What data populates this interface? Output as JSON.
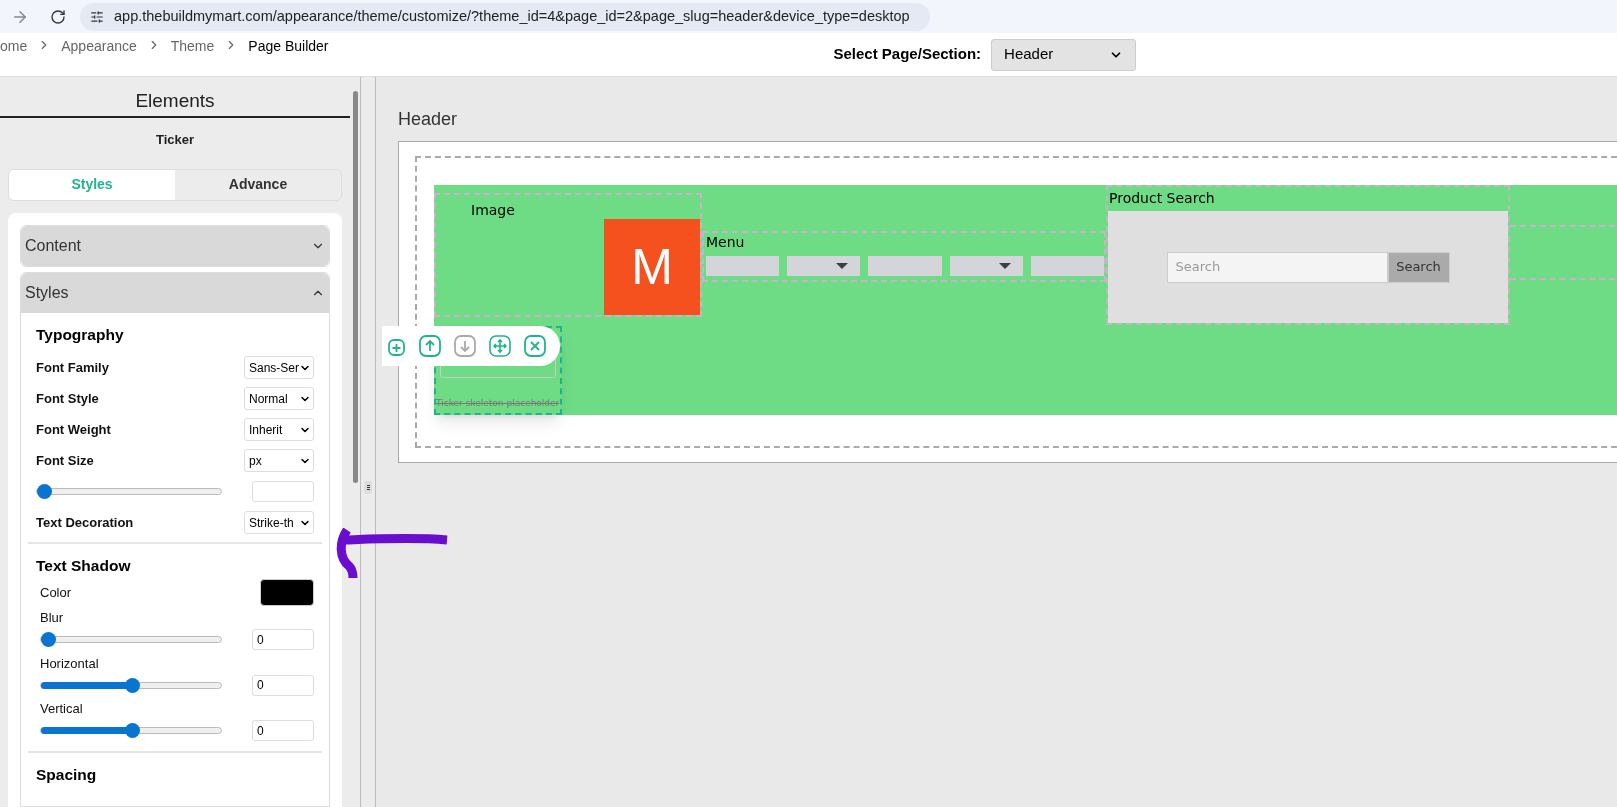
{
  "browser": {
    "url": "app.thebuildmymart.com/appearance/theme/customize/?theme_id=4&page_id=2&page_slug=header&device_type=desktop"
  },
  "breadcrumb": [
    "ome",
    "Appearance",
    "Theme",
    "Page Builder"
  ],
  "section_select": {
    "label": "Select Page/Section:",
    "value": "Header"
  },
  "sidebar": {
    "title": "Elements",
    "subtitle": "Ticker",
    "tabs": [
      {
        "label": "Styles",
        "selected": true
      },
      {
        "label": "Advance",
        "selected": false
      }
    ],
    "accordions": [
      {
        "label": "Content",
        "expanded": false
      },
      {
        "label": "Styles",
        "expanded": true
      }
    ],
    "typography": {
      "heading": "Typography",
      "rows": [
        {
          "kind": "select",
          "label": "Font Family",
          "value": "Sans-Ser"
        },
        {
          "kind": "select",
          "label": "Font Style",
          "value": "Normal"
        },
        {
          "kind": "select",
          "label": "Font Weight",
          "value": "Inherit"
        },
        {
          "kind": "select",
          "label": "Font Size",
          "value": "px"
        },
        {
          "kind": "slider",
          "level": 0
        },
        {
          "kind": "select",
          "label": "Text Decoration",
          "value": "Strike-th"
        }
      ]
    },
    "text_shadow": {
      "heading": "Text Shadow",
      "color_label": "Color",
      "color": "#000000",
      "sliders": [
        {
          "label": "Blur",
          "level": 0,
          "value": "0"
        },
        {
          "label": "Horizontal",
          "level": 0.5,
          "value": "0"
        },
        {
          "label": "Vertical",
          "level": 0.5,
          "value": "0"
        }
      ]
    },
    "spacing": {
      "heading": "Spacing"
    }
  },
  "canvas": {
    "title": "Header",
    "image_label": "Image",
    "logo_letter": "M",
    "menu_label": "Menu",
    "menu_items": [
      {
        "kind": "plain"
      },
      {
        "kind": "dropdown"
      },
      {
        "kind": "plain"
      },
      {
        "kind": "dropdown"
      },
      {
        "kind": "plain"
      }
    ],
    "product_search": {
      "label": "Product Search",
      "placeholder": "Search",
      "button": "Search"
    },
    "ticker": {
      "placeholder_text": "Ticker skeleton placeholder"
    }
  }
}
